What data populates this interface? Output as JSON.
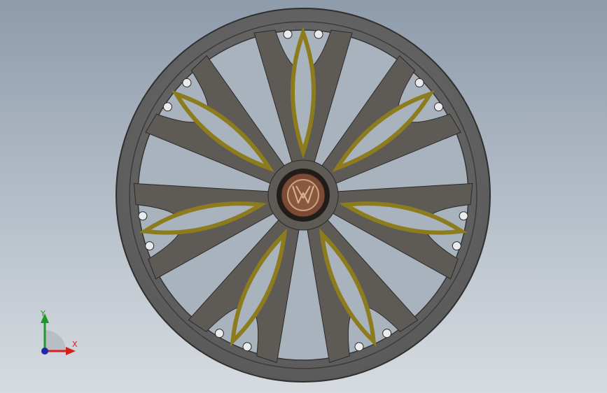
{
  "viewport": {
    "background_top": "#8e9bab",
    "background_bottom": "#d6dbe0"
  },
  "model": {
    "type": "alloy-wheel",
    "spoke_count": 7,
    "colors": {
      "rim": "#6b6b6b",
      "rim_edge": "#3a3a3a",
      "spoke": "#5e5a55",
      "window_accent": "#8d7c1e",
      "hub_cap": "#7b4a36",
      "logo_ring": "#c9a37a"
    },
    "center_logo": {
      "name": "volkswagen-logo"
    }
  },
  "triad": {
    "x_label": "X",
    "y_label": "Y",
    "x_color": "#d21f1f",
    "y_color": "#1f9a2a",
    "z_color": "#1d2ba8"
  }
}
